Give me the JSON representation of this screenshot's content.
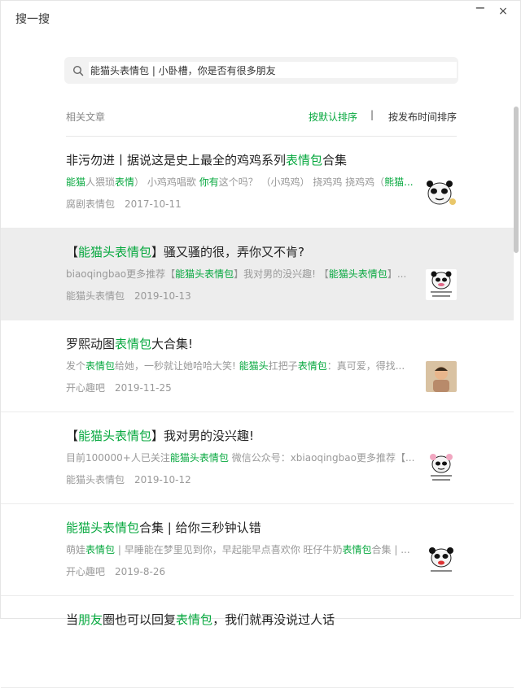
{
  "window": {
    "title": "搜一搜",
    "minimize": "−",
    "close": "×"
  },
  "search": {
    "value": "能猫头表情包 | 小卧槽，你是否有很多朋友"
  },
  "sort": {
    "label": "相关文章",
    "default": "按默认排序",
    "separator": "|",
    "by_time": "按发布时间排序"
  },
  "results": [
    {
      "title": [
        {
          "text": "非污勿进丨据说这是史上最全的鸡鸡系列"
        },
        {
          "text": "表情包",
          "hl": true
        },
        {
          "text": "合集"
        }
      ],
      "desc": [
        {
          "text": "能猫",
          "hl": true
        },
        {
          "text": "人猥琐"
        },
        {
          "text": "表情",
          "hl": true
        },
        {
          "text": "）  小鸡鸡唱歌 "
        },
        {
          "text": "你有",
          "hl": true
        },
        {
          "text": "这个吗？  （小鸡鸡）  挠鸡鸡 挠鸡鸡（"
        },
        {
          "text": "熊猫...",
          "hl": true
        }
      ],
      "source": "腐剧表情包",
      "date": "2017-10-11",
      "thumb": "panda-face-1"
    },
    {
      "title": [
        {
          "text": "【"
        },
        {
          "text": "能猫头表情包",
          "hl": true
        },
        {
          "text": "】骚又骚的很，弄你又不肯?"
        }
      ],
      "desc": [
        {
          "text": "biaoqingbao更多推荐【"
        },
        {
          "text": "能猫头表情包",
          "hl": true
        },
        {
          "text": "】我对男的没兴趣!   【"
        },
        {
          "text": "能猫头表情包",
          "hl": true
        },
        {
          "text": "】..."
        }
      ],
      "source": "能猫头表情包",
      "date": "2019-10-13",
      "thumb": "panda-face-2",
      "highlighted": true
    },
    {
      "title": [
        {
          "text": "罗熙动图"
        },
        {
          "text": "表情包",
          "hl": true
        },
        {
          "text": "大合集!"
        }
      ],
      "desc": [
        {
          "text": "发个"
        },
        {
          "text": "表情包",
          "hl": true
        },
        {
          "text": "给她，一秒就让她哈哈大笑!   "
        },
        {
          "text": "能猫头",
          "hl": true
        },
        {
          "text": "扛把子"
        },
        {
          "text": "表情包",
          "hl": true
        },
        {
          "text": "：真可爱，得找..."
        }
      ],
      "source": "开心趣吧",
      "date": "2019-11-25",
      "thumb": "kid-photo"
    },
    {
      "title": [
        {
          "text": "【"
        },
        {
          "text": "能猫头表情包",
          "hl": true
        },
        {
          "text": "】我对男的没兴趣!"
        }
      ],
      "desc": [
        {
          "text": "目前100000+人已关注"
        },
        {
          "text": "能猫头表情包",
          "hl": true
        },
        {
          "text": " 微信公众号：xbiaoqingbao更多推荐【..."
        }
      ],
      "source": "能猫头表情包",
      "date": "2019-10-12",
      "thumb": "panda-face-3"
    },
    {
      "title": [
        {
          "text": "能猫头表情包",
          "hl": true
        },
        {
          "text": "合集 | 给你三秒钟认错"
        }
      ],
      "desc": [
        {
          "text": "萌娃"
        },
        {
          "text": "表情包",
          "hl": true
        },
        {
          "text": " | 早睡能在梦里见到你，早起能早点喜欢你 旺仔牛奶"
        },
        {
          "text": "表情包",
          "hl": true
        },
        {
          "text": "合集 | ..."
        }
      ],
      "source": "开心趣吧",
      "date": "2019-8-26",
      "thumb": "panda-face-4"
    },
    {
      "title": [
        {
          "text": "当"
        },
        {
          "text": "朋友",
          "hl": true
        },
        {
          "text": "圈也可以回复"
        },
        {
          "text": "表情包",
          "hl": true
        },
        {
          "text": "，我们就再没说过人话"
        }
      ],
      "desc": [],
      "source": "",
      "date": "",
      "thumb": ""
    }
  ],
  "colors": {
    "highlight": "#07a83f",
    "selected_bg": "#ededed"
  }
}
